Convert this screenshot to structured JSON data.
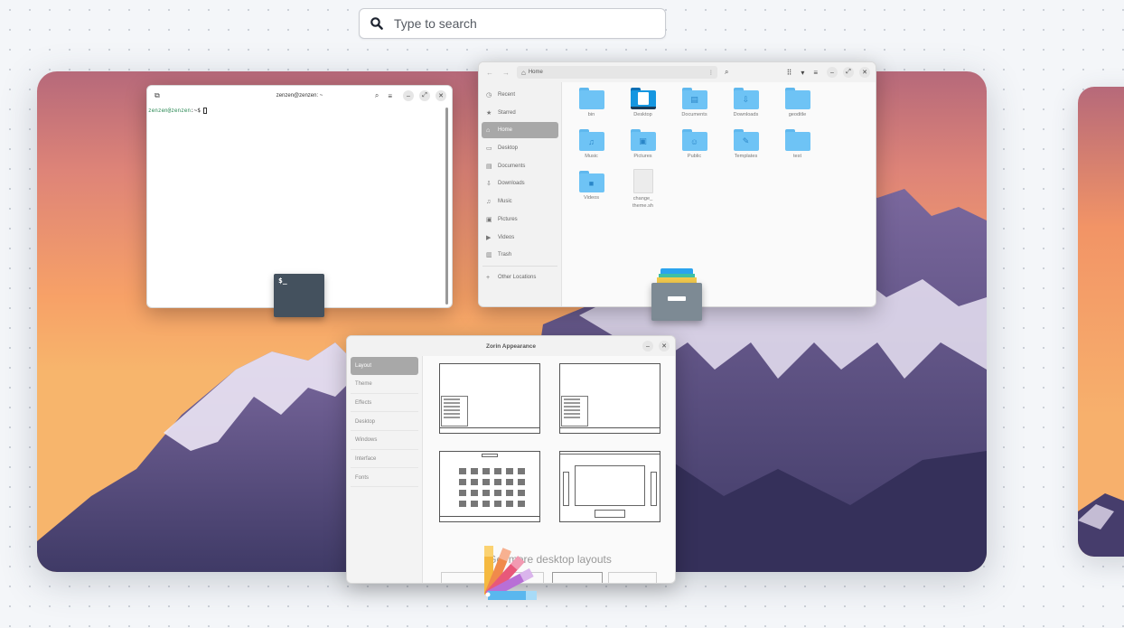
{
  "search": {
    "placeholder": "Type to search"
  },
  "terminal": {
    "title": "zenzen@zenzen: ~",
    "prompt_user": "zenzen@zenzen",
    "prompt_rest": ":~$ "
  },
  "files": {
    "path_label": "Home",
    "sidebar": [
      {
        "label": "Recent",
        "icon": "clock-icon",
        "glyph": "◷"
      },
      {
        "label": "Starred",
        "icon": "star-icon",
        "glyph": "★"
      },
      {
        "label": "Home",
        "icon": "home-icon",
        "glyph": "⌂"
      },
      {
        "label": "Desktop",
        "icon": "desktop-icon",
        "glyph": "▭"
      },
      {
        "label": "Documents",
        "icon": "document-icon",
        "glyph": "▤"
      },
      {
        "label": "Downloads",
        "icon": "download-icon",
        "glyph": "⇩"
      },
      {
        "label": "Music",
        "icon": "music-icon",
        "glyph": "♫"
      },
      {
        "label": "Pictures",
        "icon": "image-icon",
        "glyph": "▣"
      },
      {
        "label": "Videos",
        "icon": "video-icon",
        "glyph": "▶"
      },
      {
        "label": "Trash",
        "icon": "trash-icon",
        "glyph": "▥"
      },
      {
        "label": "Other Locations",
        "icon": "plus-icon",
        "glyph": "+"
      }
    ],
    "items": [
      {
        "label": "bin",
        "type": "folder",
        "glyph": ""
      },
      {
        "label": "Desktop",
        "type": "desktop",
        "glyph": ""
      },
      {
        "label": "Documents",
        "type": "folder",
        "glyph": "▤"
      },
      {
        "label": "Downloads",
        "type": "folder",
        "glyph": "⇩"
      },
      {
        "label": "geoditle",
        "type": "folder",
        "glyph": ""
      },
      {
        "label": "Music",
        "type": "folder",
        "glyph": "♫"
      },
      {
        "label": "Pictures",
        "type": "folder",
        "glyph": "▣"
      },
      {
        "label": "Public",
        "type": "folder",
        "glyph": "☺"
      },
      {
        "label": "Templates",
        "type": "folder",
        "glyph": "✎"
      },
      {
        "label": "test",
        "type": "folder",
        "glyph": ""
      },
      {
        "label": "Videos",
        "type": "folder",
        "glyph": "■"
      },
      {
        "label": "change_\ntheme.sh",
        "type": "file",
        "glyph": ""
      }
    ]
  },
  "appearance": {
    "title": "Zorin Appearance",
    "sidebar": [
      "Layout",
      "Theme",
      "Effects",
      "Desktop",
      "Windows",
      "Interface",
      "Fonts"
    ],
    "more_layouts": "Get more desktop layouts"
  },
  "terminal_icon_text": "$_",
  "colors": {
    "accent": "#5fb8ee",
    "sidebar_active": "#a8a8a8",
    "terminal_icon": "#44515e"
  }
}
